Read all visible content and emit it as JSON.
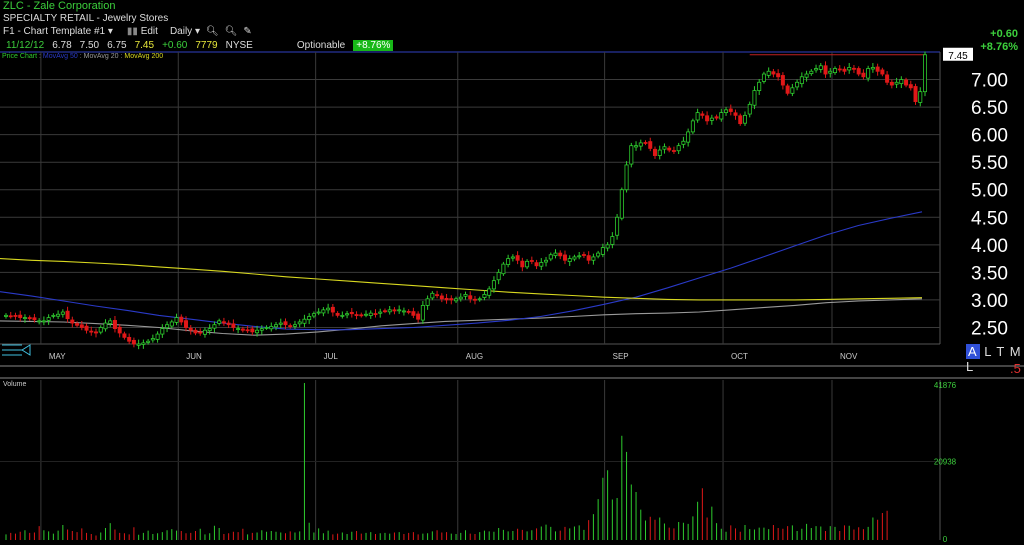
{
  "header": {
    "title": "ZLC - Zale Corporation",
    "sector": "SPECIALTY RETAIL - Jewelry Stores",
    "template": "F1 - Chart Template #1",
    "edit": "Edit",
    "period": "Daily"
  },
  "quote": {
    "date": "11/12/12",
    "open": "6.78",
    "high": "7.50",
    "low": "6.75",
    "close": "7.45",
    "change": "+0.60",
    "volume": "7779",
    "exchange": "NYSE",
    "optionable": "Optionable",
    "pct": "+8.76%"
  },
  "top_right": {
    "change": "+0.60",
    "pct": "+8.76%"
  },
  "legend": {
    "price": "Price Chart",
    "ma50": "MovAvg 50",
    "ma20": "MovAvg 20",
    "ma200": "MovAvg 200"
  },
  "altml": {
    "a": "A",
    "rest": "L T M L"
  },
  "five": ".5",
  "colors": {
    "up": "#2ecc2e",
    "down": "#e01818",
    "ma20": "#9a9a9a",
    "ma50": "#2a3ac8",
    "ma200": "#d8d820",
    "grid": "#3a3a3a"
  },
  "chart_data": [
    {
      "type": "candlestick",
      "title": "Price Chart",
      "ylim": [
        2.2,
        7.5
      ],
      "y_ticks": [
        "7.00",
        "6.50",
        "6.00",
        "5.50",
        "5.00",
        "4.50",
        "4.00",
        "3.50",
        "3.00",
        "2.50"
      ],
      "y_tick_values": [
        7.0,
        6.5,
        6.0,
        5.5,
        5.0,
        4.5,
        4.0,
        3.5,
        3.0,
        2.5
      ],
      "last_price_label": "7.45",
      "month_labels": [
        "MAY",
        "JUN",
        "JUL",
        "AUG",
        "SEP",
        "OCT",
        "NOV"
      ],
      "month_start_index": [
        8,
        37,
        66,
        96,
        127,
        152,
        175
      ],
      "resistance": 7.45,
      "closes": [
        2.72,
        2.71,
        2.7,
        2.68,
        2.68,
        2.66,
        2.64,
        2.62,
        2.62,
        2.68,
        2.72,
        2.74,
        2.78,
        2.66,
        2.58,
        2.54,
        2.5,
        2.45,
        2.42,
        2.4,
        2.5,
        2.58,
        2.62,
        2.48,
        2.4,
        2.32,
        2.25,
        2.2,
        2.2,
        2.22,
        2.25,
        2.3,
        2.38,
        2.48,
        2.55,
        2.6,
        2.68,
        2.6,
        2.5,
        2.45,
        2.4,
        2.4,
        2.45,
        2.48,
        2.55,
        2.62,
        2.58,
        2.55,
        2.5,
        2.48,
        2.45,
        2.45,
        2.42,
        2.45,
        2.48,
        2.5,
        2.52,
        2.55,
        2.58,
        2.55,
        2.52,
        2.55,
        2.6,
        2.65,
        2.7,
        2.75,
        2.78,
        2.82,
        2.85,
        2.78,
        2.72,
        2.72,
        2.75,
        2.75,
        2.73,
        2.72,
        2.74,
        2.76,
        2.75,
        2.78,
        2.8,
        2.82,
        2.8,
        2.82,
        2.8,
        2.78,
        2.72,
        2.65,
        2.9,
        3.02,
        3.12,
        3.08,
        3.02,
        3.0,
        3.0,
        3.02,
        3.05,
        3.1,
        3.02,
        3.0,
        3.02,
        3.1,
        3.2,
        3.35,
        3.5,
        3.65,
        3.75,
        3.78,
        3.72,
        3.6,
        3.7,
        3.7,
        3.62,
        3.68,
        3.72,
        3.82,
        3.85,
        3.8,
        3.72,
        3.75,
        3.78,
        3.8,
        3.82,
        3.72,
        3.78,
        3.85,
        3.95,
        4.0,
        4.15,
        4.5,
        5.0,
        5.45,
        5.8,
        5.8,
        5.85,
        5.85,
        5.75,
        5.62,
        5.72,
        5.78,
        5.72,
        5.7,
        5.8,
        5.88,
        6.05,
        6.25,
        6.4,
        6.35,
        6.25,
        6.3,
        6.3,
        6.4,
        6.45,
        6.42,
        6.35,
        6.2,
        6.35,
        6.55,
        6.8,
        6.95,
        7.1,
        7.15,
        7.1,
        7.05,
        6.9,
        6.75,
        6.85,
        6.95,
        7.05,
        7.1,
        7.15,
        7.2,
        7.25,
        7.1,
        7.15,
        7.2,
        7.18,
        7.15,
        7.22,
        7.2,
        7.1,
        7.05,
        7.2,
        7.22,
        7.15,
        7.1,
        6.95,
        6.9,
        6.95,
        7.0,
        6.9,
        6.85,
        6.6,
        6.78,
        7.45
      ],
      "series": [
        {
          "name": "MovAvg 20",
          "values": [
            2.62,
            2.61,
            2.6,
            2.57,
            2.54,
            2.5,
            2.44,
            2.39,
            2.36,
            2.38,
            2.42,
            2.47,
            2.53,
            2.57,
            2.61,
            2.63,
            2.65,
            2.67,
            2.7,
            2.73,
            2.75,
            2.76,
            2.78,
            2.82,
            2.86,
            2.9,
            2.95,
            2.98,
            3.0,
            3.02
          ]
        },
        {
          "name": "MovAvg 50",
          "values": [
            3.15,
            3.07,
            2.98,
            2.89,
            2.81,
            2.72,
            2.65,
            2.58,
            2.52,
            2.47,
            2.46,
            2.46,
            2.48,
            2.5,
            2.54,
            2.58,
            2.63,
            2.7,
            2.8,
            2.92,
            3.05,
            3.22,
            3.4,
            3.58,
            3.78,
            3.98,
            4.18,
            4.35,
            4.48,
            4.6
          ]
        },
        {
          "name": "MovAvg 200",
          "values": [
            3.75,
            3.72,
            3.7,
            3.67,
            3.64,
            3.6,
            3.56,
            3.52,
            3.47,
            3.42,
            3.38,
            3.34,
            3.3,
            3.26,
            3.22,
            3.18,
            3.14,
            3.11,
            3.08,
            3.05,
            3.03,
            3.01,
            3.0,
            3.0,
            3.0,
            3.0,
            3.01,
            3.02,
            3.03,
            3.04
          ]
        }
      ]
    },
    {
      "type": "bar",
      "title": "Volume",
      "ylim": [
        0,
        41876
      ],
      "y_ticks": [
        "41876",
        "20938",
        "0"
      ],
      "values": [
        1500,
        1900,
        1700,
        2200,
        2600,
        1900,
        2000,
        3700,
        2600,
        2300,
        1700,
        2500,
        4000,
        2800,
        2400,
        2100,
        3100,
        1900,
        1600,
        1200,
        2000,
        3200,
        4500,
        2800,
        1900,
        1800,
        1500,
        3400,
        1400,
        1900,
        2500,
        1600,
        1800,
        2100,
        2600,
        2900,
        2500,
        2400,
        1800,
        1900,
        2400,
        3000,
        1500,
        1800,
        3800,
        3200,
        1600,
        1800,
        2200,
        2100,
        3000,
        1500,
        1900,
        2000,
        2600,
        2200,
        2400,
        2200,
        2000,
        1800,
        2300,
        2000,
        2300,
        41876,
        4600,
        2000,
        3100,
        1800,
        2500,
        1500,
        1700,
        2000,
        1600,
        2200,
        2400,
        1700,
        1900,
        2100,
        1600,
        1800,
        1900,
        1700,
        2000,
        2100,
        1600,
        1900,
        2100,
        1500,
        1700,
        1800,
        2300,
        2600,
        2000,
        2100,
        1700,
        1600,
        1900,
        2600,
        1700,
        1600,
        2100,
        2500,
        2300,
        2200,
        3200,
        2700,
        2300,
        2400,
        3000,
        2700,
        2300,
        2600,
        3100,
        3600,
        4100,
        3500,
        2300,
        2500,
        3500,
        3100,
        3600,
        3900,
        2700,
        5300,
        6900,
        10900,
        16600,
        18600,
        10800,
        11200,
        27800,
        23500,
        14800,
        12800,
        8100,
        5200,
        6200,
        5400,
        6000,
        4400,
        3300,
        3100,
        4800,
        4600,
        4300,
        6300,
        10200,
        13800,
        6000,
        8900,
        4500,
        3000,
        2200,
        3900,
        3100,
        2200,
        4000,
        2900,
        2800,
        3300,
        3300,
        2900,
        4000,
        3200,
        3000,
        3700,
        3900,
        2400,
        3000,
        4300,
        3200,
        3700,
        3600,
        2400,
        3700,
        3500,
        2400,
        3900,
        3800,
        2800,
        3400,
        2900,
        3500,
        6000,
        5400,
        7200,
        7800
      ]
    }
  ]
}
